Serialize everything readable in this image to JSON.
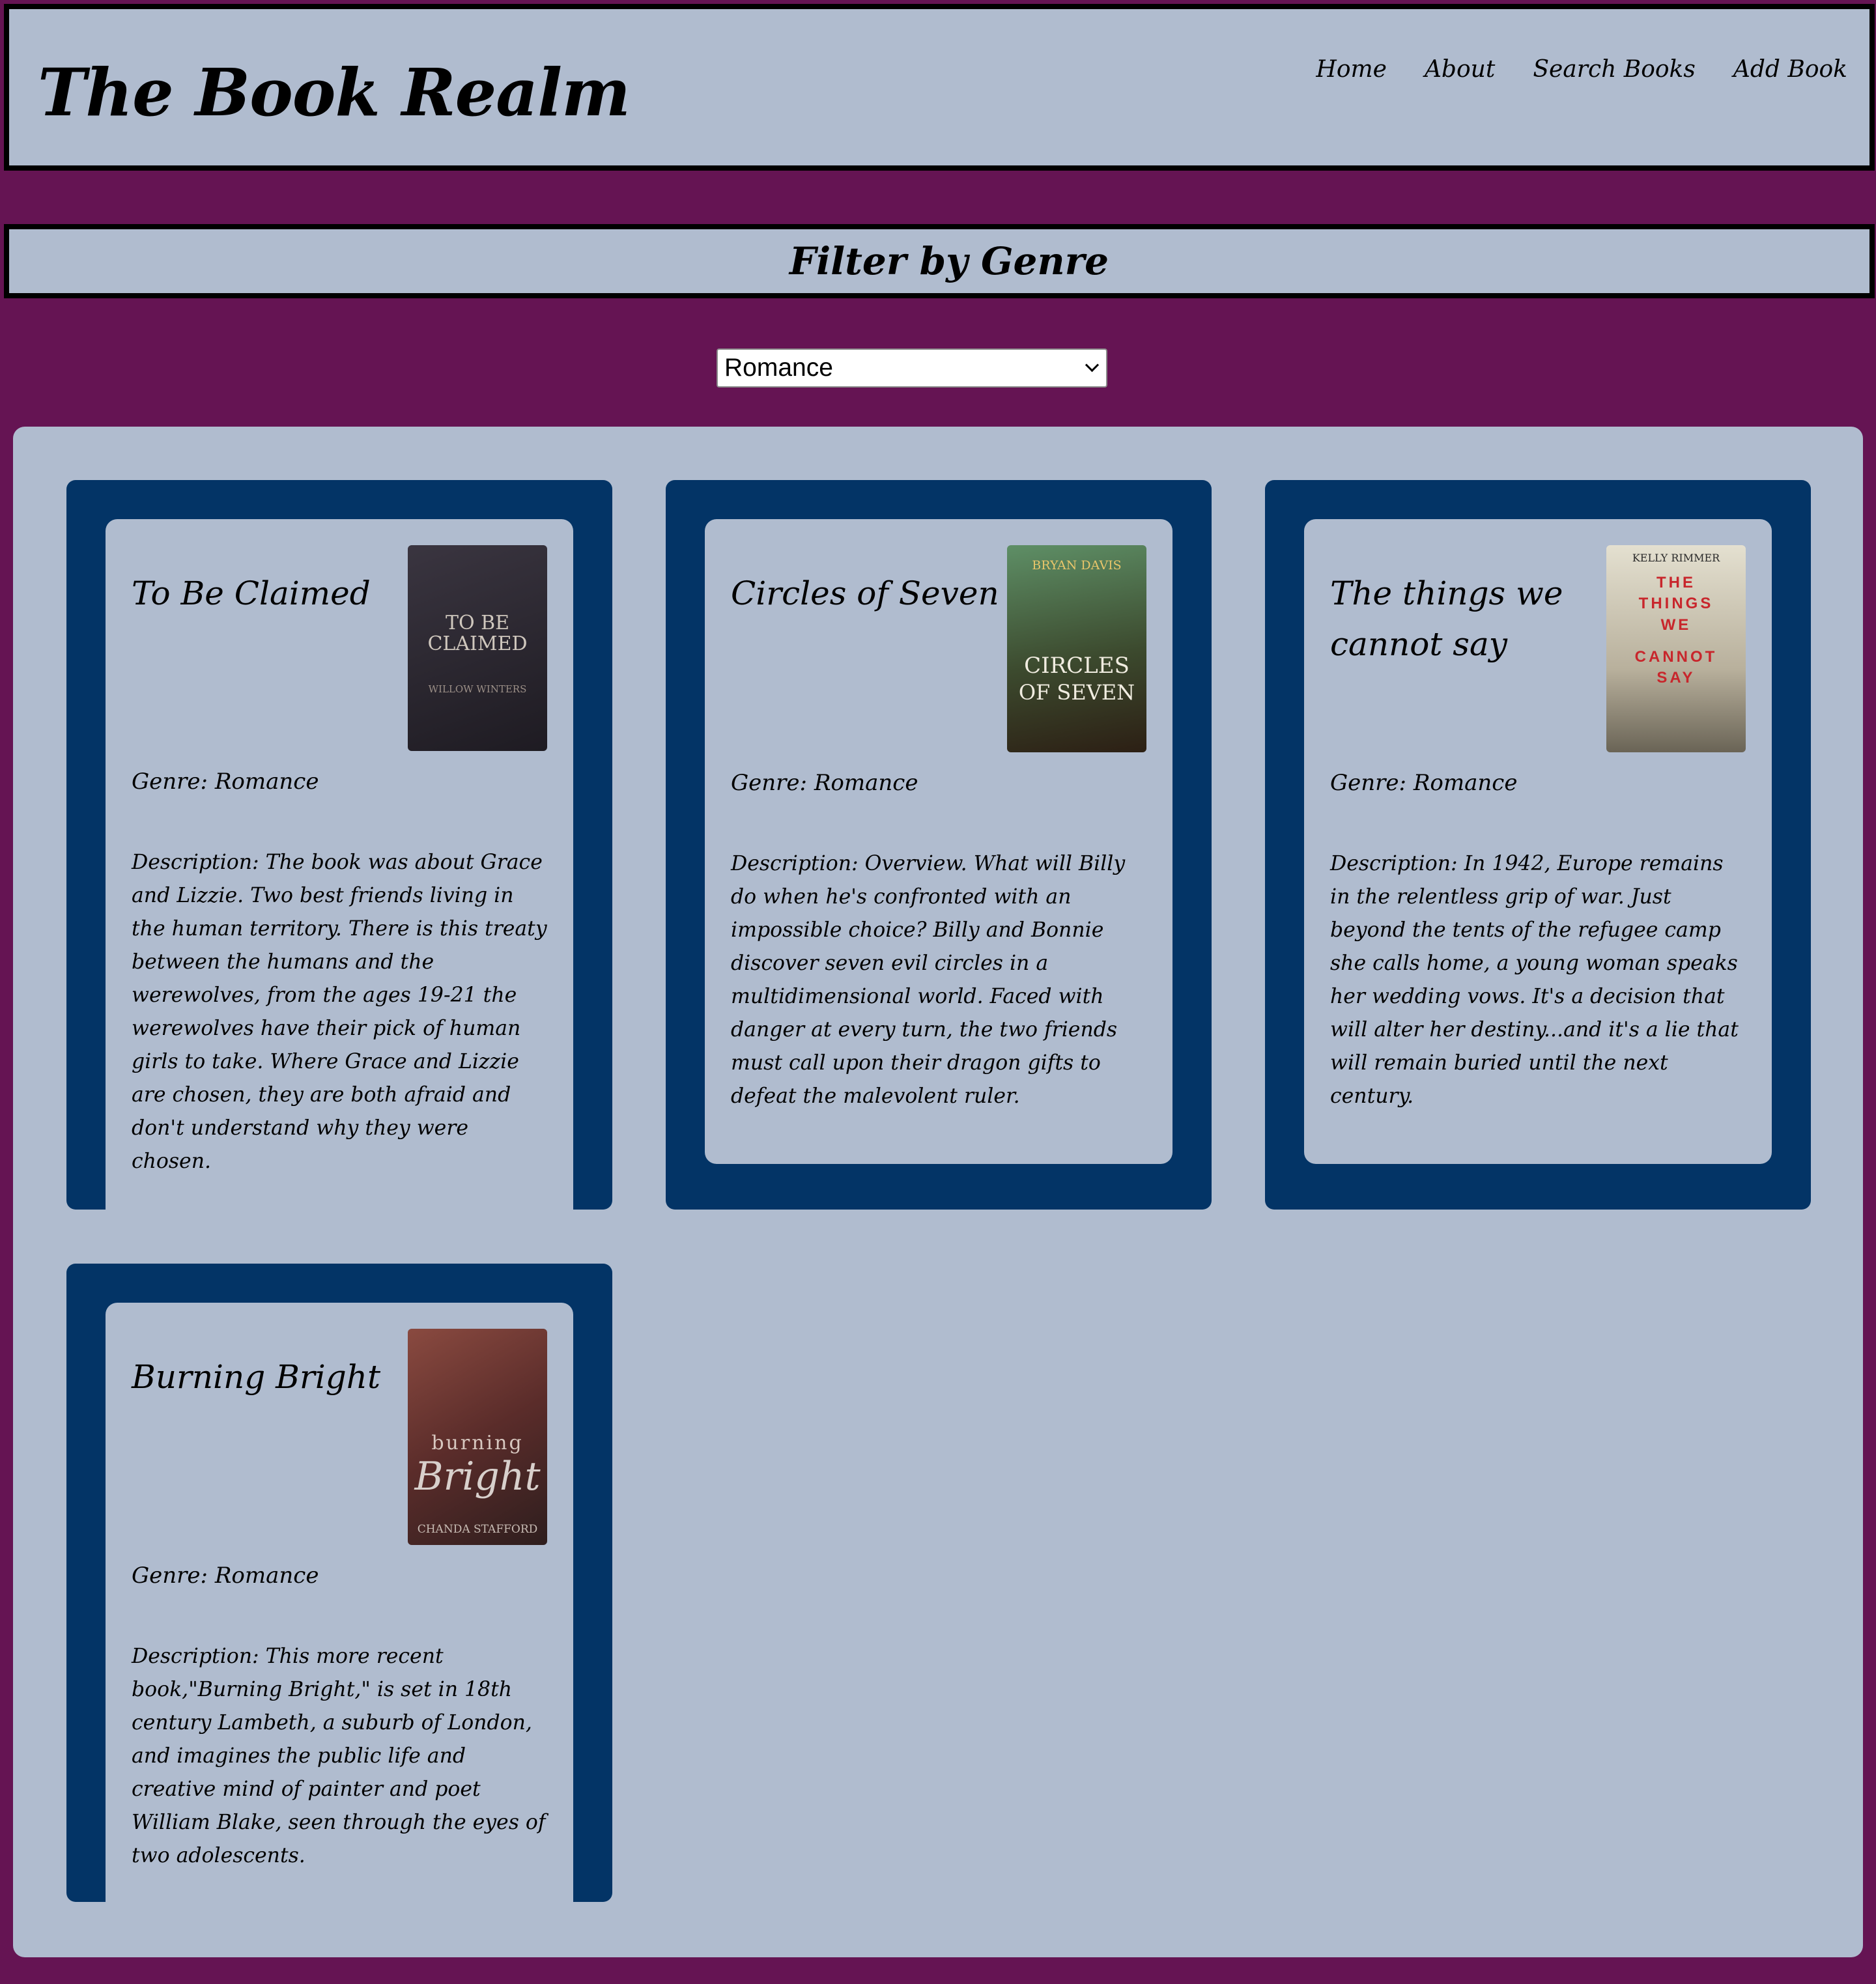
{
  "header": {
    "title": "The Book Realm",
    "nav": [
      "Home",
      "About",
      "Search Books",
      "Add Book"
    ]
  },
  "filter": {
    "heading": "Filter by Genre",
    "selected": "Romance"
  },
  "books": [
    {
      "title": "To Be Claimed",
      "genre_label": "Genre: Romance",
      "description": "Description: The book was about Grace and Lizzie. Two best friends living in the human territory. There is this treaty between the humans and the werewolves, from the ages 19-21 the werewolves have their pick of human girls to take. Where Grace and Lizzie are chosen, they are both afraid and don't understand why they were chosen.",
      "cover": {
        "line1": "TO BE",
        "line2": "CLAIMED",
        "author": "WILLOW WINTERS",
        "colors": [
          "#2a2730",
          "#4a3b3a"
        ]
      }
    },
    {
      "title": "Circles of Seven",
      "genre_label": "Genre: Romance",
      "description": "Description: Overview. What will Billy do when he's confronted with an impossible choice? Billy and Bonnie discover seven evil circles in a multidimensional world. Faced with danger at every turn, the two friends must call upon their dragon gifts to defeat the malevolent ruler.",
      "cover": {
        "line1": "CIRCLES",
        "line2": "OF SEVEN",
        "author": "BRYAN DAVIS",
        "colors": [
          "#4a7a4a",
          "#3b2a1c"
        ]
      }
    },
    {
      "title": "The things we cannot say",
      "genre_label": "Genre: Romance",
      "description": "Description: In 1942, Europe remains in the relentless grip of war. Just beyond the tents of the refugee camp she calls home, a young woman speaks her wedding vows. It's a decision that will alter her destiny...and it's a lie that will remain buried until the next century.",
      "cover": {
        "line1": "THE THINGS WE",
        "line2": "CANNOT SAY",
        "author": "KELLY RIMMER",
        "colors": [
          "#d8d4c4",
          "#6e6a60"
        ]
      }
    },
    {
      "title": "Burning Bright",
      "genre_label": "Genre: Romance",
      "description": "Description: This more recent book,\"Burning Bright,\" is set in 18th century Lambeth, a suburb of London, and imagines the public life and creative mind of painter and poet William Blake, seen through the eyes of two adolescents.",
      "cover": {
        "line1": "burning",
        "line2": "Bright",
        "author": "CHANDA STAFFORD",
        "colors": [
          "#7a3a36",
          "#3a2424"
        ]
      }
    }
  ]
}
